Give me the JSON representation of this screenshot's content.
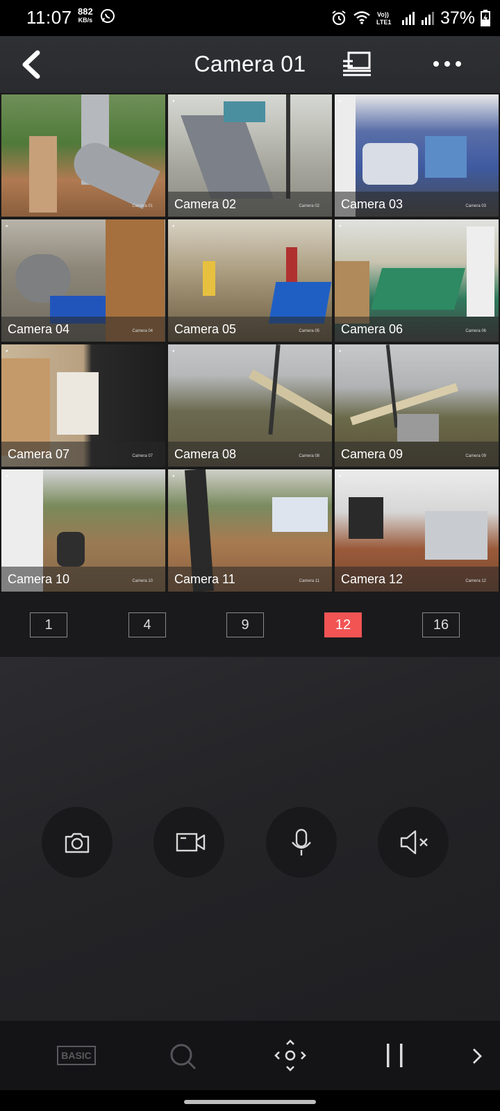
{
  "status_bar": {
    "time": "11:07",
    "net_speed": "882",
    "net_speed_unit": "KB/s",
    "battery_percent": "37%"
  },
  "header": {
    "title": "Camera 01"
  },
  "cameras": [
    {
      "label": "Camera 01",
      "osd": "Camera 01"
    },
    {
      "label": "Camera 02",
      "osd": "Camera 02"
    },
    {
      "label": "Camera 03",
      "osd": "Camera 03"
    },
    {
      "label": "Camera 04",
      "osd": "Camera 04"
    },
    {
      "label": "Camera 05",
      "osd": "Camera 05"
    },
    {
      "label": "Camera 06",
      "osd": "Camera 06"
    },
    {
      "label": "Camera 07",
      "osd": "Camera 07"
    },
    {
      "label": "Camera 08",
      "osd": "Camera 08"
    },
    {
      "label": "Camera 09",
      "osd": "Camera 09"
    },
    {
      "label": "Camera 10",
      "osd": "Camera 10"
    },
    {
      "label": "Camera 11",
      "osd": "Camera 11"
    },
    {
      "label": "Camera 12",
      "osd": "Camera 12"
    }
  ],
  "layout_options": [
    "1",
    "4",
    "9",
    "12",
    "16"
  ],
  "layout_selected": "12",
  "controls": {
    "snapshot_icon": "camera-icon",
    "record_icon": "video-camera-icon",
    "talk_icon": "microphone-icon",
    "audio_icon": "speaker-muted-icon"
  },
  "toolbar": {
    "basic_label": "BASIC",
    "zoom_icon": "search-icon",
    "ptz_icon": "ptz-direction-icon",
    "pause_icon": "pause-icon",
    "next_icon": "chevron-right-icon"
  },
  "colors": {
    "accent": "#f25454",
    "selected_border": "#e84a4a",
    "header_bg": "#2f3034",
    "control_button_bg": "#19191b"
  }
}
